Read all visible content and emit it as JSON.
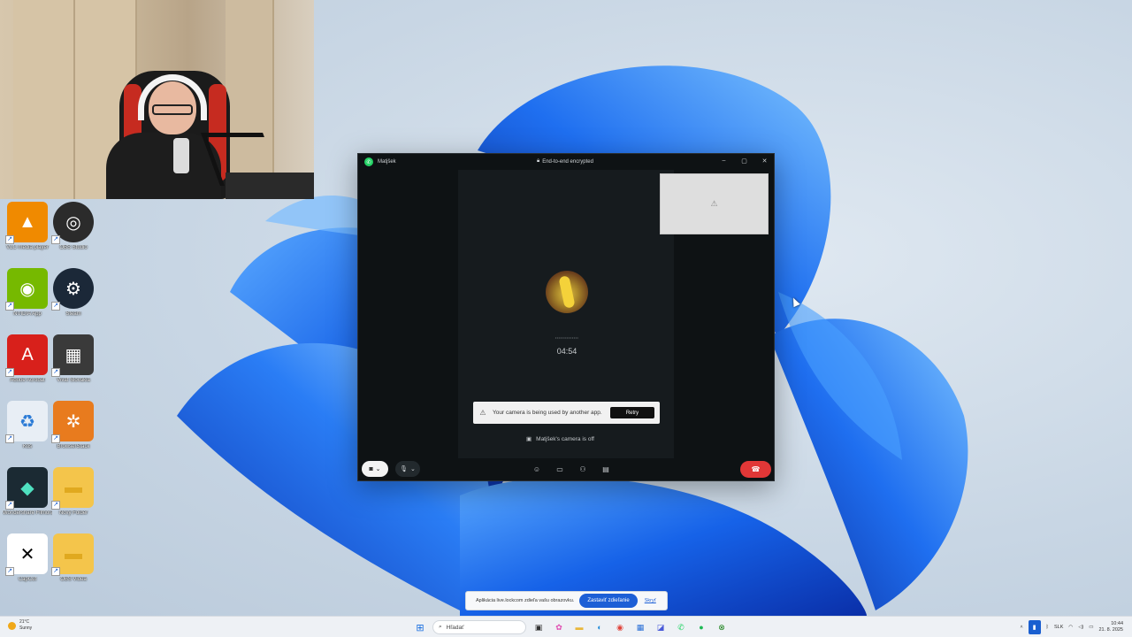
{
  "wallpaper": {
    "name": "windows-11-bloom"
  },
  "webcam": {
    "description_hidden": ""
  },
  "desktop_icons": [
    {
      "label": "VLC media player",
      "icon": "vlc-icon",
      "color": "#f08a00"
    },
    {
      "label": "OBS Studio",
      "icon": "obs-icon",
      "color": "#2b2b2b"
    },
    {
      "label": "NVIDIA App",
      "icon": "nvidia-icon",
      "color": "#76b900"
    },
    {
      "label": "Steam",
      "icon": "steam-icon",
      "color": "#1b2838"
    },
    {
      "label": "Adobe Acrobat",
      "icon": "acrobat-icon",
      "color": "#d8201b"
    },
    {
      "label": "Vivat Slovakia",
      "icon": "vivat-icon",
      "color": "#3a3a3a"
    },
    {
      "label": "Kôš",
      "icon": "recycle-bin-icon",
      "color": "#e8eef5"
    },
    {
      "label": "BrowserStack",
      "icon": "app-icon",
      "color": "#e87b1e"
    },
    {
      "label": "Wondershare Filmora 14",
      "icon": "filmora-icon",
      "color": "#1b2a33"
    },
    {
      "label": "Nový Folder",
      "icon": "folder-icon",
      "color": "#f4c54b"
    },
    {
      "label": "CapCut",
      "icon": "capcut-icon",
      "color": "#ffffff"
    },
    {
      "label": "OBS Videá",
      "icon": "folder-icon",
      "color": "#f4c54b"
    }
  ],
  "call": {
    "contact_name": "Matjšek",
    "encryption_label": "End-to-end encrypted",
    "status_dots": "••••••••••••••",
    "timer": "04:54",
    "self_preview_icon": "⚠",
    "warning_text": "Your camera is being used by another app.",
    "retry_label": "Retry",
    "camera_off_text": "Matjšek's camera is off",
    "accent_green": "#25d366",
    "end_call_color": "#e13737"
  },
  "share_bar": {
    "message": "Aplikácia live.lockcom zdieľa vašu obrazovku.",
    "stop_label": "Zastaviť zdieľanie",
    "hide_label": "Skryť"
  },
  "taskbar": {
    "weather_temp": "21°C",
    "weather_cond": "Sunny",
    "search_placeholder": "Hľadať",
    "lang": "SLK",
    "time": "10:44",
    "date": "21. 8. 2025"
  }
}
